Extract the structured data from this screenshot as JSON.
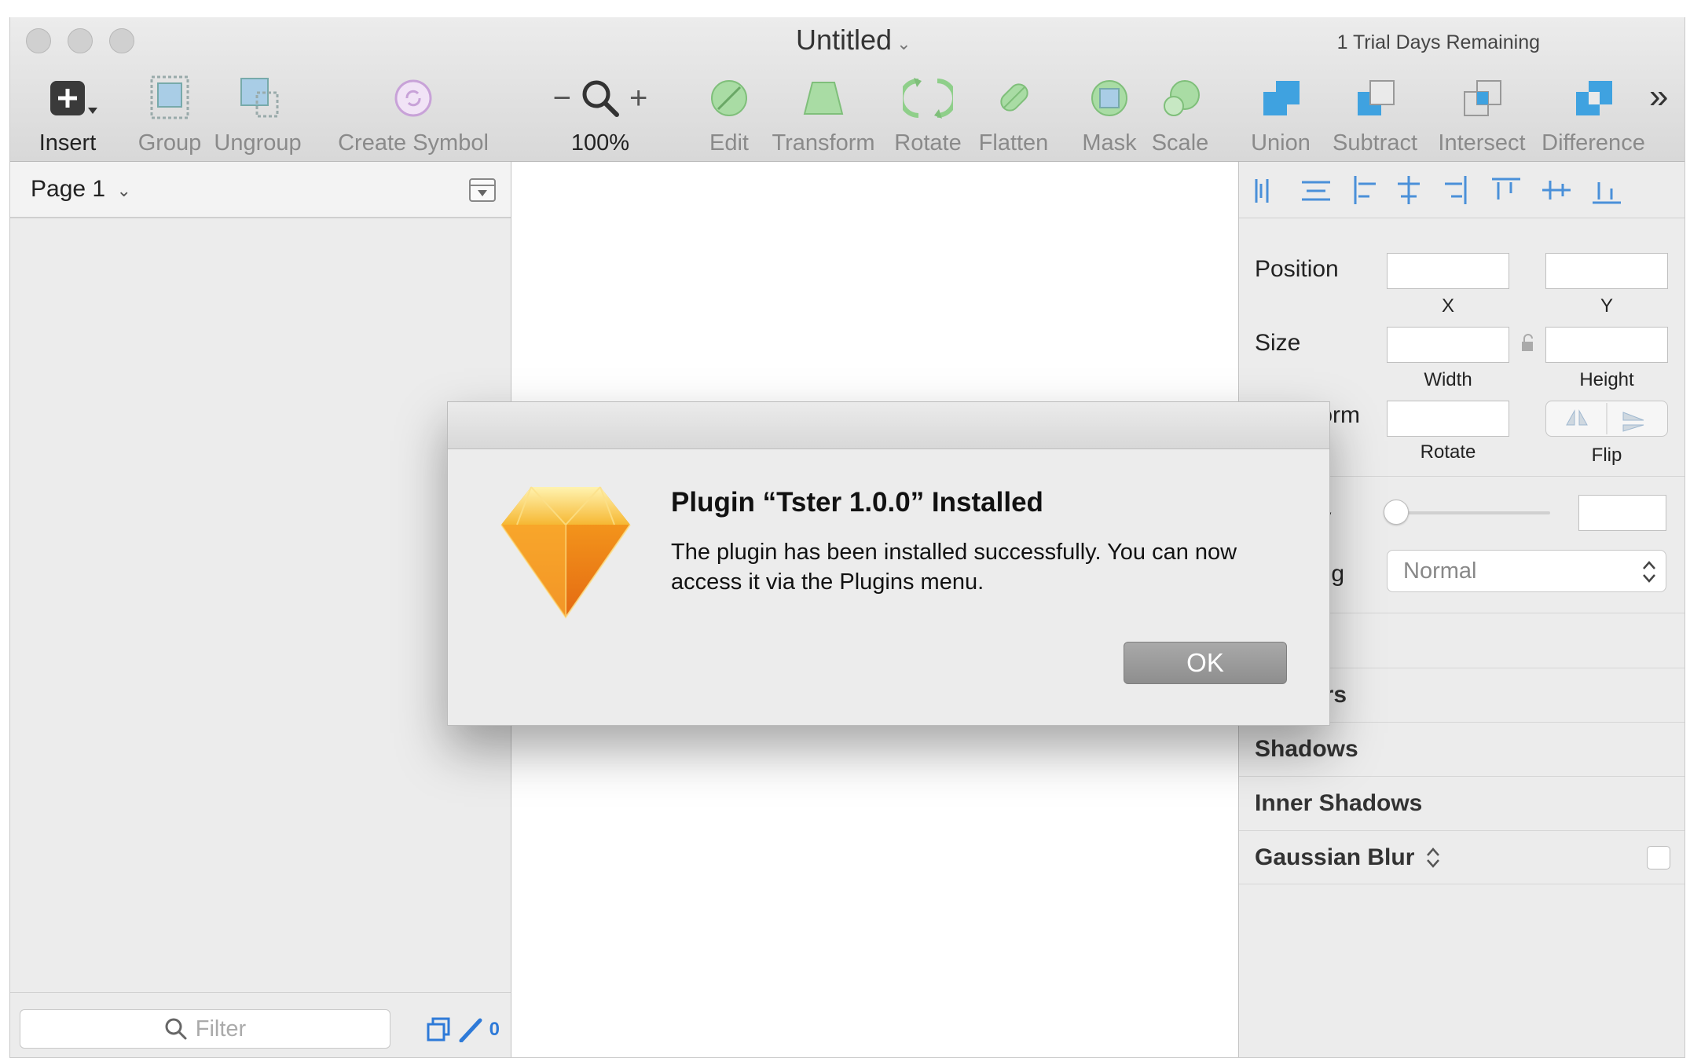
{
  "window": {
    "title": "Untitled",
    "trial_text": "1 Trial Days Remaining"
  },
  "toolbar": {
    "insert": "Insert",
    "group": "Group",
    "ungroup": "Ungroup",
    "create_symbol": "Create Symbol",
    "zoom_minus": "−",
    "zoom_plus": "+",
    "zoom": "100%",
    "edit": "Edit",
    "transform": "Transform",
    "rotate": "Rotate",
    "flatten": "Flatten",
    "mask": "Mask",
    "scale": "Scale",
    "union": "Union",
    "subtract": "Subtract",
    "intersect": "Intersect",
    "difference": "Difference",
    "overflow": "»"
  },
  "pages": {
    "current": "Page 1",
    "filter_placeholder": "Filter",
    "count": "0"
  },
  "inspector": {
    "position_label": "Position",
    "x_label": "X",
    "y_label": "Y",
    "size_label": "Size",
    "width_label": "Width",
    "height_label": "Height",
    "transform_label": "form",
    "rotate_label": "Rotate",
    "flip_label": "Flip",
    "opacity_label": "ty",
    "blending_label": "ing",
    "blending_value": "Normal",
    "borders_label": "ers",
    "shadows_label": "Shadows",
    "inner_shadows_label": "Inner Shadows",
    "gaussian_blur_label": "Gaussian Blur",
    "gaussian_blur_chev": "⌃⌄"
  },
  "dialog": {
    "heading": "Plugin “Tster 1.0.0” Installed",
    "message": "The plugin has been installed successfully. You can now access it via the Plugins menu.",
    "ok_label": "OK"
  },
  "colors": {
    "accent_blue": "#2e7ad8",
    "boolean_blue": "#3fa2e0",
    "edit_green": "#8fcf8a",
    "gem_orange": "#f5a623"
  }
}
